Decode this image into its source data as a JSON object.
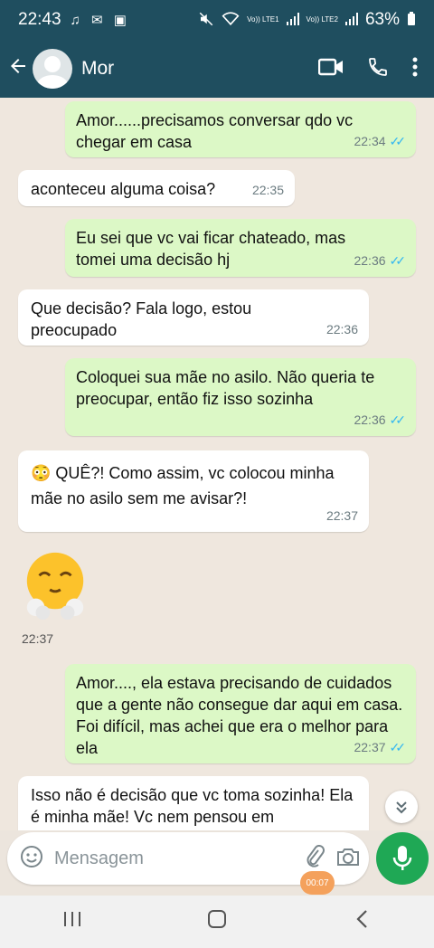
{
  "status_bar": {
    "time": "22:43",
    "left_icons": "♫ ✉ ▣",
    "net1": "Vo)) LTE1",
    "net2": "Vo)) LTE2",
    "battery": "63%"
  },
  "app_bar": {
    "contact_name": "Mor"
  },
  "messages": [
    {
      "dir": "out",
      "text": "Amor......precisamos conversar qdo vc chegar em casa",
      "time": "22:34",
      "ticks": "✓✓"
    },
    {
      "dir": "in",
      "text": "aconteceu alguma coisa?",
      "time": "22:35"
    },
    {
      "dir": "out",
      "text": "Eu sei que vc vai ficar chateado, mas tomei uma decisão hj",
      "time": "22:36",
      "ticks": "✓✓"
    },
    {
      "dir": "in",
      "text": "Que decisão? Fala logo, estou preocupado",
      "time": "22:36"
    },
    {
      "dir": "out",
      "text": "Coloquei sua mãe no asilo. Não queria te preocupar, então fiz isso sozinha",
      "time": "22:36",
      "ticks": "✓✓"
    },
    {
      "dir": "in",
      "text": "😳 QUÊ?! Como assim, vc colocou minha mãe no asilo sem me avisar?!",
      "time": "22:37"
    },
    {
      "dir": "in",
      "text": "",
      "time": "22:37",
      "emoji": "😤"
    },
    {
      "dir": "out",
      "text": "Amor...., ela estava precisando de cuidados que a gente não consegue dar aqui em casa. Foi difícil, mas achei que era o melhor para ela",
      "time": "22:37",
      "ticks": "✓✓"
    },
    {
      "dir": "in",
      "text": "Isso não é decisão que vc toma sozinha! Ela é minha mãe! Vc nem pensou em",
      "time": ""
    }
  ],
  "composer": {
    "placeholder": "Mensagem",
    "recording_badge": "00:07"
  },
  "icons": {
    "back": "arrow-left-icon",
    "video": "video-camera-icon",
    "call": "phone-icon",
    "menu": "more-vert-icon",
    "emoji": "smiley-icon",
    "attach": "paperclip-icon",
    "camera": "camera-icon",
    "mic": "microphone-icon",
    "scroll": "chevrons-down-icon"
  },
  "colors": {
    "app_bar": "#1f4e5f",
    "outgoing_bubble": "#dcf8c6",
    "incoming_bubble": "#ffffff",
    "mic_button": "#1fa855",
    "read_ticks": "#34b7f1"
  }
}
